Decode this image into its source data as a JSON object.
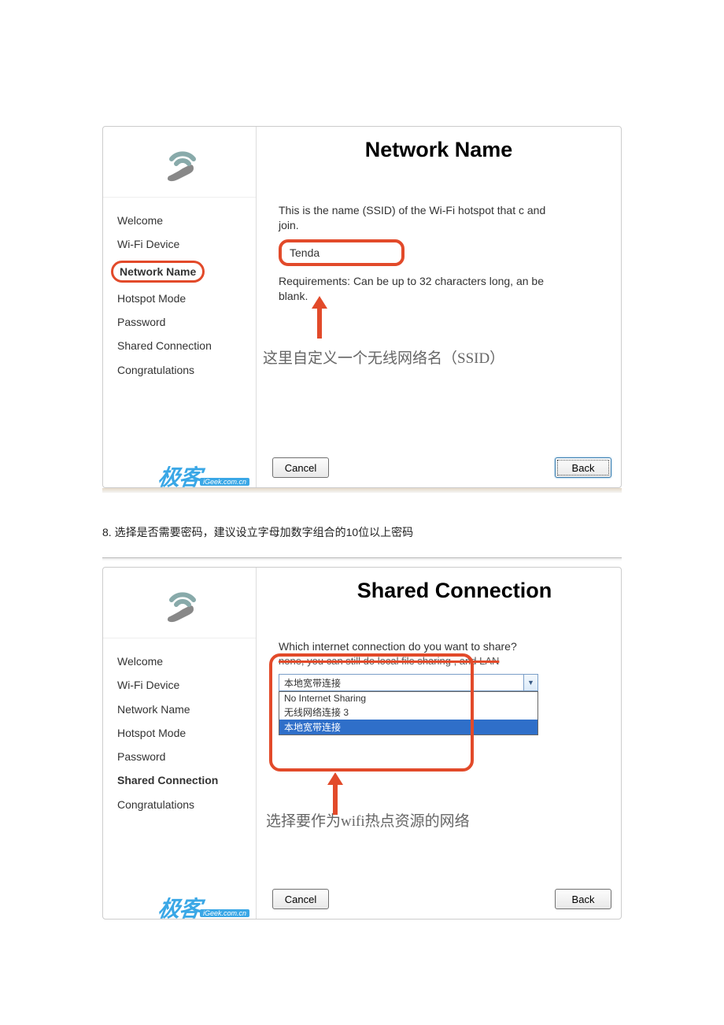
{
  "screenshot1": {
    "title": "Network Name",
    "sidebar": {
      "steps": [
        "Welcome",
        "Wi-Fi Device",
        "Network Name",
        "Hotspot Mode",
        "Password",
        "Shared Connection",
        "Congratulations"
      ],
      "active_index": 2
    },
    "watermark": {
      "logo": "极客",
      "url": "iGeek.com.cn"
    },
    "body": {
      "desc": "This is the name (SSID) of the Wi-Fi hotspot that c and join.",
      "ssid_value": "Tenda",
      "requirements_label": "Requirements:",
      "requirements_text": "Can be up to 32 characters long, an be blank.",
      "annotation": "这里自定义一个无线网络名（SSID）"
    },
    "buttons": {
      "cancel": "Cancel",
      "back": "Back"
    }
  },
  "caption": {
    "num": "8.",
    "text": "选择是否需要密码，建议设立字母加数字组合的10位以上密码"
  },
  "screenshot2": {
    "title": "Shared Connection",
    "sidebar": {
      "steps": [
        "Welcome",
        "Wi-Fi Device",
        "Network Name",
        "Hotspot Mode",
        "Password",
        "Shared Connection",
        "Congratulations"
      ],
      "active_index": 5
    },
    "watermark": {
      "logo": "极客",
      "url": "iGeek.com.cn"
    },
    "body": {
      "question": "Which internet connection do you want to share?",
      "struck_line": "none, you can still do local file sharing , and LAN ",
      "combo_value": "本地宽带连接",
      "dropdown": [
        "No Internet Sharing",
        "无线网络连接 3",
        "本地宽带连接"
      ],
      "dropdown_selected_index": 2,
      "annotation": "选择要作为wifi热点资源的网络"
    },
    "buttons": {
      "cancel": "Cancel",
      "back": "Back"
    }
  }
}
